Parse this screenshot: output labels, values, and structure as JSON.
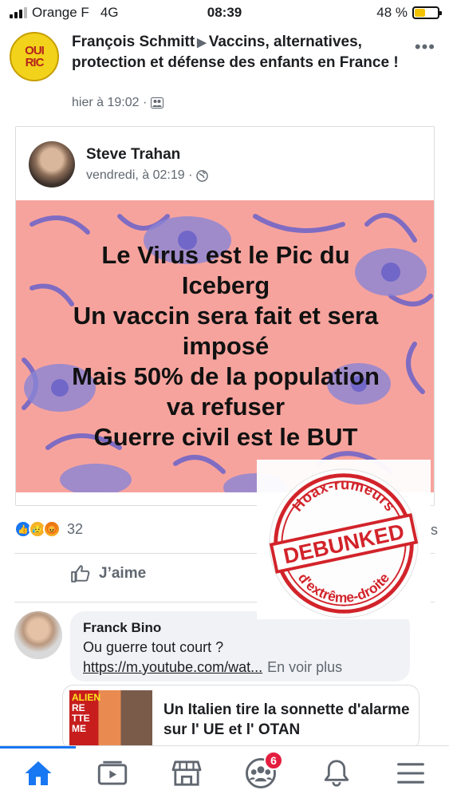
{
  "status_bar": {
    "carrier": "Orange F",
    "network": "4G",
    "time": "08:39",
    "battery": "48 %",
    "battery_level": 0.48,
    "battery_color": "#f3c300"
  },
  "post": {
    "group_logo_lines": [
      "OUI",
      "RIC"
    ],
    "author": "François Schmitt",
    "separator_icon": "triangle-right-icon",
    "group_name": "Vaccins, alternatives, protection et défense des enfants en France !",
    "time": "hier à 19:02 ·",
    "audience_icon": "group-members-icon"
  },
  "shared_post": {
    "author": "Steve Trahan",
    "time": "vendredi, à 02:19 ·",
    "audience_icon": "globe-icon",
    "quote_lines": [
      "Le Virus est le Pic du",
      "Iceberg",
      "Un vaccin sera fait et sera",
      "imposé",
      "Mais 50% de la population",
      "va refuser",
      "Guerre civil est le BUT"
    ],
    "background_color": "#f7a39d"
  },
  "reactions": {
    "icons": [
      "like-icon",
      "sad-icon",
      "angry-icon"
    ],
    "count": "32",
    "right_text": "s"
  },
  "actions": {
    "like_label": "J’aime"
  },
  "comment": {
    "author": "Franck Bino",
    "text": "Ou guerre tout court ?",
    "link": "https://m.youtube.com/wat...",
    "see_more": "En voir plus"
  },
  "link_preview": {
    "thumb_text": [
      "ALIEN",
      "RE",
      "TTE",
      "ME"
    ],
    "title": "Un Italien tire la sonnette d'alarme sur l' UE et l' OTAN"
  },
  "stamp": {
    "top_text": "Hoax-rumeurs",
    "center_text": "DEBUNKED",
    "bottom_text": "d'extrême-droite",
    "color": "#d2232a"
  },
  "tabbar": {
    "active_color": "#1877f2",
    "tabs": [
      "home-icon",
      "watch-icon",
      "marketplace-icon",
      "groups-icon",
      "notifications-icon",
      "menu-icon"
    ],
    "groups_badge": "6"
  }
}
